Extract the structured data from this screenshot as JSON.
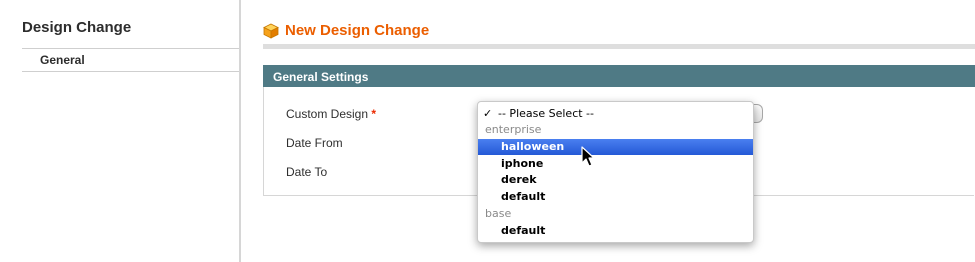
{
  "sidebar": {
    "title": "Design Change",
    "tabs": [
      {
        "label": "General",
        "active": true
      }
    ]
  },
  "header": {
    "icon": "cube-icon",
    "title": "New Design Change",
    "title_color": "#eb5e00"
  },
  "fieldset": {
    "legend": "General Settings",
    "legend_bg": "#4f7a85",
    "fields": [
      {
        "label": "Custom Design",
        "required_mark": "*"
      },
      {
        "label": "Date From"
      },
      {
        "label": "Date To"
      }
    ]
  },
  "dropdown": {
    "selected": "-- Please Select --",
    "check_mark": "✓",
    "options": [
      {
        "label": "-- Please Select --",
        "type": "option",
        "checked": true
      },
      {
        "label": "enterprise",
        "type": "group"
      },
      {
        "label": "halloween",
        "type": "child",
        "highlighted": true
      },
      {
        "label": "iphone",
        "type": "child"
      },
      {
        "label": "derek",
        "type": "child"
      },
      {
        "label": "default",
        "type": "child"
      },
      {
        "label": "base",
        "type": "group"
      },
      {
        "label": "default",
        "type": "child"
      }
    ],
    "highlight_color": "#2f66e0"
  }
}
